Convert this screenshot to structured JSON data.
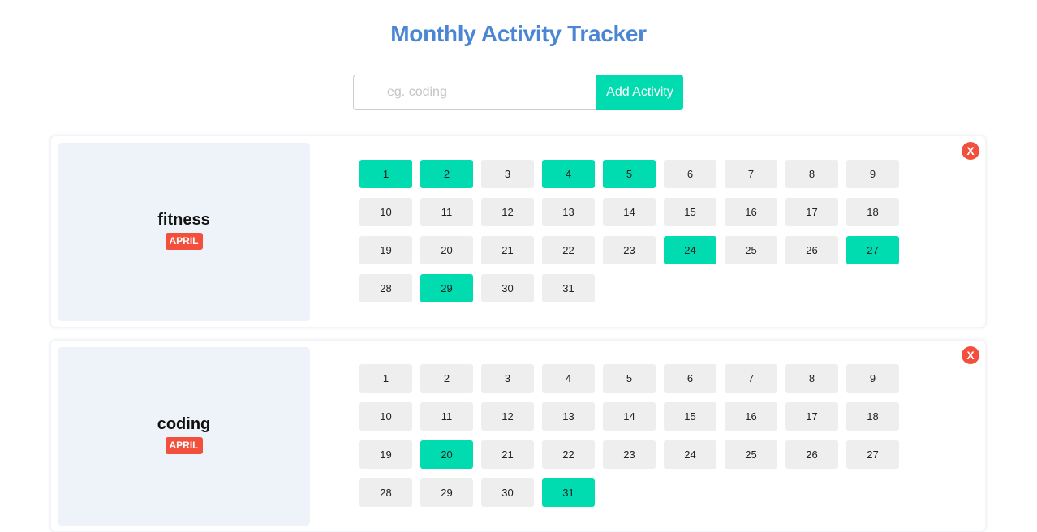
{
  "header": {
    "title": "Monthly Activity Tracker"
  },
  "form": {
    "placeholder": "eg. coding",
    "value": "",
    "add_label": "Add Activity"
  },
  "colors": {
    "title": "#4a86d4",
    "accent": "#00dbb0",
    "badge": "#f24f3c",
    "day_default": "#eeeeee",
    "panel": "#eef2f9"
  },
  "icons": {
    "delete": "close-icon"
  },
  "activities": [
    {
      "name": "fitness",
      "month": "APRIL",
      "delete_label": "X",
      "days": [
        "1",
        "2",
        "3",
        "4",
        "5",
        "6",
        "7",
        "8",
        "9",
        "10",
        "11",
        "12",
        "13",
        "14",
        "15",
        "16",
        "17",
        "18",
        "19",
        "20",
        "21",
        "22",
        "23",
        "24",
        "25",
        "26",
        "27",
        "28",
        "29",
        "30",
        "31"
      ],
      "completed": [
        "1",
        "2",
        "4",
        "5",
        "24",
        "27",
        "29"
      ]
    },
    {
      "name": "coding",
      "month": "APRIL",
      "delete_label": "X",
      "days": [
        "1",
        "2",
        "3",
        "4",
        "5",
        "6",
        "7",
        "8",
        "9",
        "10",
        "11",
        "12",
        "13",
        "14",
        "15",
        "16",
        "17",
        "18",
        "19",
        "20",
        "21",
        "22",
        "23",
        "24",
        "25",
        "26",
        "27",
        "28",
        "29",
        "30",
        "31"
      ],
      "completed": [
        "20",
        "31"
      ]
    }
  ]
}
